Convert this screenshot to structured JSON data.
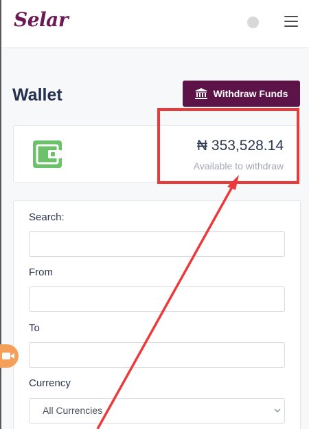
{
  "header": {
    "logo_text": "Selar",
    "menu_icon": "hamburger-menu-icon",
    "avatar_icon": "user-avatar-icon"
  },
  "page": {
    "title": "Wallet",
    "withdraw_button_label": "Withdraw Funds",
    "withdraw_button_icon": "bank-icon"
  },
  "balance": {
    "amount": "₦ 353,528.14",
    "caption": "Available to withdraw",
    "icon": "wallet-icon"
  },
  "filters": {
    "search_label": "Search:",
    "search_value": "",
    "from_label": "From",
    "from_value": "",
    "to_label": "To",
    "to_value": "",
    "currency_label": "Currency",
    "currency_selected": "All Currencies"
  },
  "colors": {
    "brand": "#6b1a55",
    "button": "#5c1347",
    "wallet_icon": "#6cc26a",
    "annotation": "#ec3a3a"
  }
}
